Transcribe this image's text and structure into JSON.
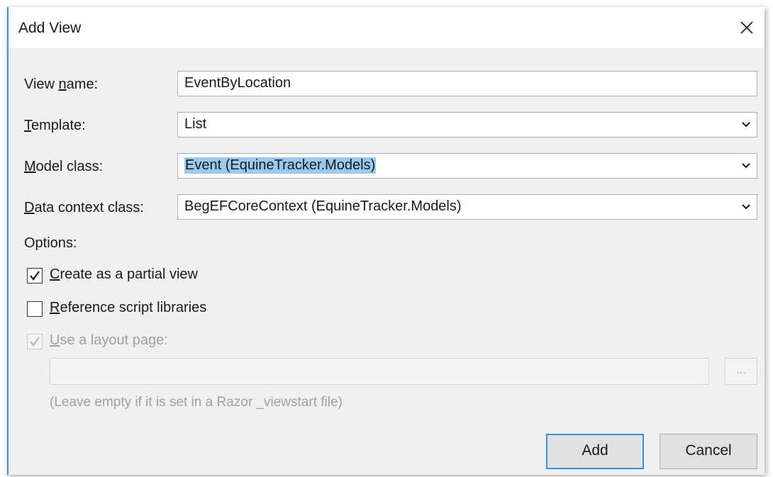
{
  "dialog": {
    "title": "Add View",
    "close_icon": "close-icon"
  },
  "fields": {
    "view_name": {
      "label_underlined": "n",
      "label_pre": "View ",
      "label_post": "ame:",
      "value": "EventByLocation"
    },
    "template": {
      "label_underlined": "T",
      "label_pre": "",
      "label_post": "emplate:",
      "value": "List"
    },
    "model_class": {
      "label_underlined": "M",
      "label_pre": "",
      "label_post": "odel class:",
      "value": "Event (EquineTracker.Models)"
    },
    "data_context_class": {
      "label_underlined": "D",
      "label_pre": "",
      "label_post": "ata context class:",
      "value": "BegEFCoreContext (EquineTracker.Models)"
    }
  },
  "options": {
    "heading": "Options:",
    "partial_view": {
      "label_underlined": "C",
      "label_post": "reate as a partial view",
      "checked": true
    },
    "reference_scripts": {
      "label_underlined": "R",
      "label_post": "eference script libraries",
      "checked": false
    },
    "use_layout": {
      "label_underlined": "U",
      "label_post": "se a layout page:",
      "checked": true,
      "disabled": true
    },
    "layout_path": "",
    "browse_label": "...",
    "hint": "(Leave empty if it is set in a Razor _viewstart file)"
  },
  "buttons": {
    "add": "Add",
    "cancel": "Cancel"
  },
  "colors": {
    "accent": "#3c8ed6",
    "selection": "#99c9ef",
    "dialog_bg": "#f0f0f0"
  }
}
